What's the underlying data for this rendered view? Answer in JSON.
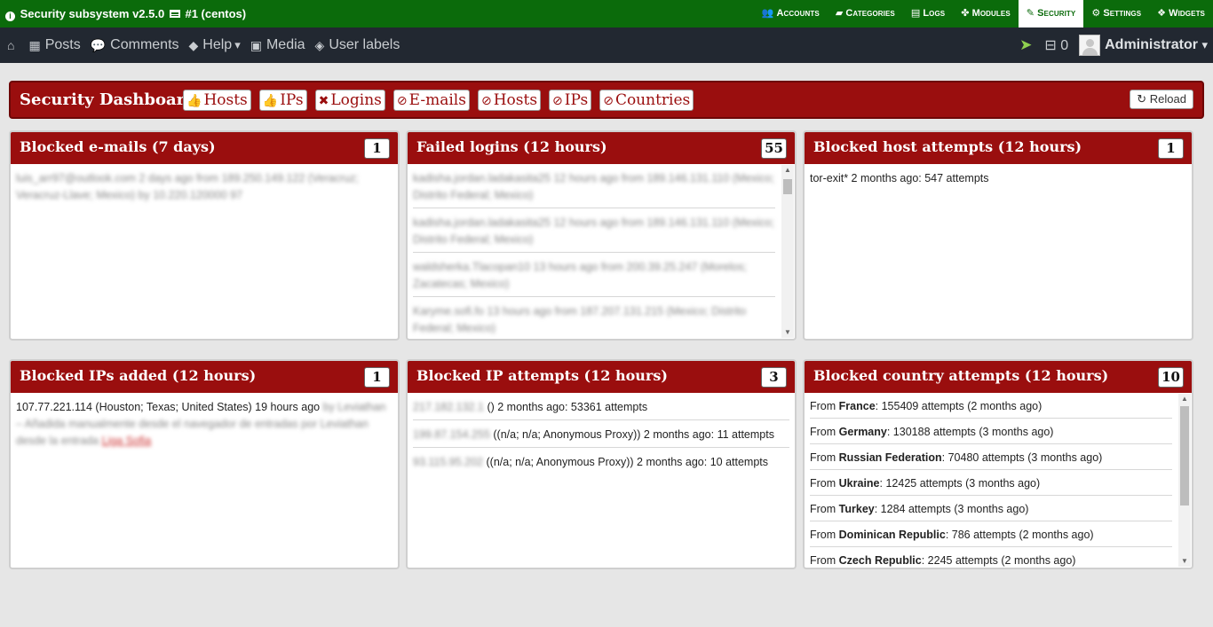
{
  "topbar": {
    "brand": "Security subsystem v2.5.0",
    "brand_suffix": "#1 (centos)",
    "nav": [
      {
        "label": "Accounts",
        "icon": "users-icon",
        "glyph": "👥"
      },
      {
        "label": "Categories",
        "icon": "folder-icon",
        "glyph": "▰"
      },
      {
        "label": "Logs",
        "icon": "file-icon",
        "glyph": "▤"
      },
      {
        "label": "Modules",
        "icon": "puzzle-icon",
        "glyph": "✤"
      },
      {
        "label": "Security",
        "icon": "pencil-icon",
        "glyph": "✎",
        "active": true
      },
      {
        "label": "Settings",
        "icon": "gears-icon",
        "glyph": "⚙"
      },
      {
        "label": "Widgets",
        "icon": "cubes-icon",
        "glyph": "❖"
      }
    ]
  },
  "navbar": {
    "items": [
      {
        "label": "Posts",
        "icon": "newspaper-icon",
        "glyph": "▦"
      },
      {
        "label": "Comments",
        "icon": "comments-icon",
        "glyph": "💬"
      },
      {
        "label": "Help",
        "icon": "tag-icon",
        "glyph": "◆"
      },
      {
        "label": "Media",
        "icon": "image-icon",
        "glyph": "▣"
      },
      {
        "label": "User labels",
        "icon": "tags-icon",
        "glyph": "◈"
      }
    ],
    "help_caret": "▾",
    "inbox_count": "0",
    "user": "Administrator"
  },
  "dashboard": {
    "title": "Security Dashboard",
    "chips": [
      {
        "label": "Hosts",
        "icon": "thumbs-up-icon",
        "glyph": "👍"
      },
      {
        "label": "IPs",
        "icon": "thumbs-up-icon",
        "glyph": "👍"
      },
      {
        "label": "Logins",
        "icon": "times-icon",
        "glyph": "✖"
      },
      {
        "label": "E-mails",
        "icon": "ban-icon",
        "glyph": "⊘"
      },
      {
        "label": "Hosts",
        "icon": "ban-icon",
        "glyph": "⊘"
      },
      {
        "label": "IPs",
        "icon": "ban-icon",
        "glyph": "⊘"
      },
      {
        "label": "Countries",
        "icon": "ban-icon",
        "glyph": "⊘"
      }
    ],
    "reload": "Reload"
  },
  "panels": {
    "blocked_emails": {
      "title": "Blocked e-mails (7 days)",
      "count": "1",
      "rows": [
        {
          "blur": "luis_arr97@outlook.com 2 days ago from 189.250.149.122 (Veracruz; Veracruz-Llave; Mexico) by 10.220.120000 97"
        }
      ]
    },
    "failed_logins": {
      "title": "Failed logins (12 hours)",
      "count": "55",
      "rows": [
        {
          "blur": "kadisha.jordan.ladakasita25 12 hours ago from 189.146.131.110 (Mexico; Distrito Federal; Mexico)"
        },
        {
          "blur": "kadisha.jordan.ladakasita25 12 hours ago from 189.146.131.110 (Mexico; Distrito Federal; Mexico)"
        },
        {
          "blur": "waldsherka.Tlacopan10 13 hours ago from 200.39.25.247 (Morelos; Zacatecas; Mexico)"
        },
        {
          "blur": "Karyme.sofi.fo 13 hours ago from 187.207.131.215 (Mexico; Distrito Federal; Mexico)"
        }
      ]
    },
    "blocked_host_attempts": {
      "title": "Blocked host attempts (12 hours)",
      "count": "1",
      "rows": [
        {
          "text": "tor-exit* 2 months ago: 547 attempts"
        }
      ]
    },
    "blocked_ips_added": {
      "title": "Blocked IPs added (12 hours)",
      "count": "1",
      "row": {
        "text": "107.77.221.114 (Houston; Texas; United States) 19 hours ago",
        "blur": "by Leviathan – Añadida manualmente desde el navegador de entradas por Leviathan desde la entrada",
        "link": "Liga Sofia"
      }
    },
    "blocked_ip_attempts": {
      "title": "Blocked IP attempts (12 hours)",
      "count": "3",
      "rows": [
        {
          "blur": "217.182.132.1",
          "text": "() 2 months ago: 53361 attempts"
        },
        {
          "blur": "199.87.154.255",
          "text": "((n/a; n/a; Anonymous Proxy)) 2 months ago: 11 attempts"
        },
        {
          "blur": "93.115.95.202",
          "text": "((n/a; n/a; Anonymous Proxy)) 2 months ago: 10 attempts"
        }
      ]
    },
    "blocked_country_attempts": {
      "title": "Blocked country attempts (12 hours)",
      "count": "10",
      "from_label": "From",
      "rows": [
        {
          "country": "France",
          "text": ": 155409 attempts (2 months ago)"
        },
        {
          "country": "Germany",
          "text": ": 130188 attempts (3 months ago)"
        },
        {
          "country": "Russian Federation",
          "text": ": 70480 attempts (3 months ago)"
        },
        {
          "country": "Ukraine",
          "text": ": 12425 attempts (3 months ago)"
        },
        {
          "country": "Turkey",
          "text": ": 1284 attempts (3 months ago)"
        },
        {
          "country": "Dominican Republic",
          "text": ": 786 attempts (2 months ago)"
        },
        {
          "country": "Czech Republic",
          "text": ": 2245 attempts (2 months ago)"
        }
      ]
    }
  }
}
